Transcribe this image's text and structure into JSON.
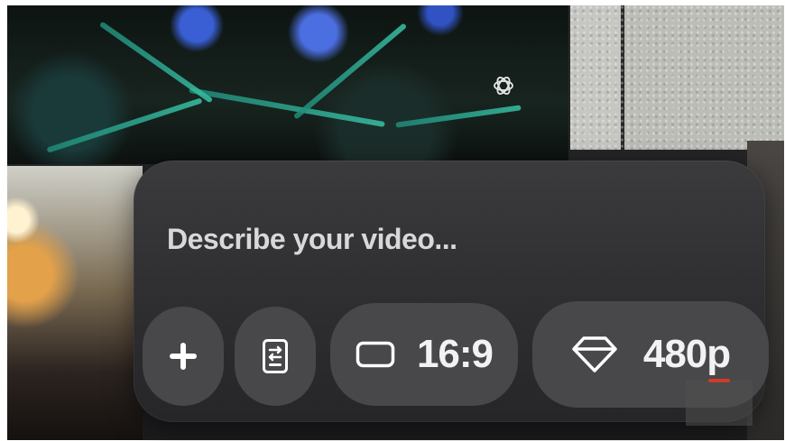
{
  "prompt": {
    "placeholder": "Describe your video..."
  },
  "toolbar": {
    "add_icon": "plus-icon",
    "storyboard_icon": "storyboard-icon",
    "aspect_icon": "rectangle-icon",
    "aspect_ratio": "16:9",
    "quality_icon": "diamond-icon",
    "resolution": "480p"
  },
  "watermark": {
    "icon": "openai-logo-icon"
  },
  "colors": {
    "panel": "#2e2e30",
    "pill": "#48484b",
    "text": "#f2f2f4",
    "placeholder": "#d8d8dc"
  }
}
